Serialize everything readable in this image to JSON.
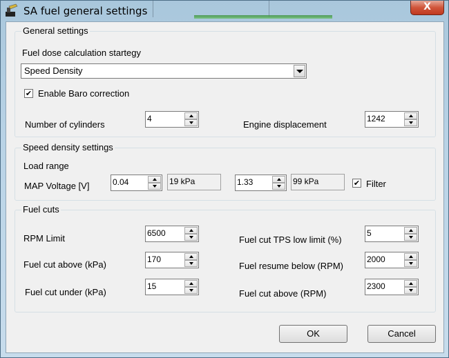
{
  "window": {
    "title": "SA fuel general settings",
    "close_glyph": "X"
  },
  "general": {
    "title": "General settings",
    "strategy_label": "Fuel dose calculation startegy",
    "strategy_value": "Speed Density",
    "baro_label": "Enable Baro correction",
    "baro_checked": true,
    "cylinders_label": "Number of cylinders",
    "cylinders_value": "4",
    "displacement_label": "Engine displacement",
    "displacement_value": "1242"
  },
  "speed_density": {
    "title": "Speed density settings",
    "load_range_label": "Load range",
    "map_label": "MAP Voltage [V]",
    "map_low_value": "0.04",
    "map_low_kpa": "19 kPa",
    "map_high_value": "1.33",
    "map_high_kpa": "99 kPa",
    "filter_label": "Filter",
    "filter_checked": true
  },
  "fuel_cuts": {
    "title": "Fuel cuts",
    "rpm_limit_label": "RPM Limit",
    "rpm_limit_value": "6500",
    "cut_above_kpa_label": "Fuel cut above (kPa)",
    "cut_above_kpa_value": "170",
    "cut_under_kpa_label": "Fuel cut under (kPa)",
    "cut_under_kpa_value": "15",
    "tps_low_label": "Fuel cut TPS low limit (%)",
    "tps_low_value": "5",
    "resume_below_label": "Fuel resume below (RPM)",
    "resume_below_value": "2000",
    "cut_above_rpm_label": "Fuel cut above (RPM)",
    "cut_above_rpm_value": "2300"
  },
  "buttons": {
    "ok": "OK",
    "cancel": "Cancel"
  },
  "checkmark": "✔"
}
